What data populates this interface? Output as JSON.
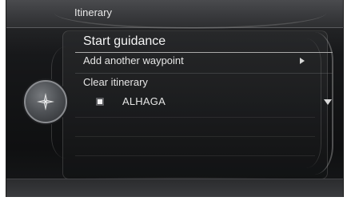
{
  "header": {
    "breadcrumb": "Itinerary"
  },
  "menu": {
    "items": [
      {
        "label": "Start guidance"
      },
      {
        "label": "Add another waypoint",
        "icon": "arrow-right-icon"
      },
      {
        "label": "Clear itinerary"
      },
      {
        "label": "ALHAGA",
        "icon": "waypoint-marker-icon",
        "expand_icon": "arrow-down-icon"
      }
    ]
  },
  "controls": {
    "knob_icon": "compass-star-icon"
  },
  "colors": {
    "text": "#e6e6e6",
    "background": "#141516",
    "accent": "#a9a9a9"
  }
}
